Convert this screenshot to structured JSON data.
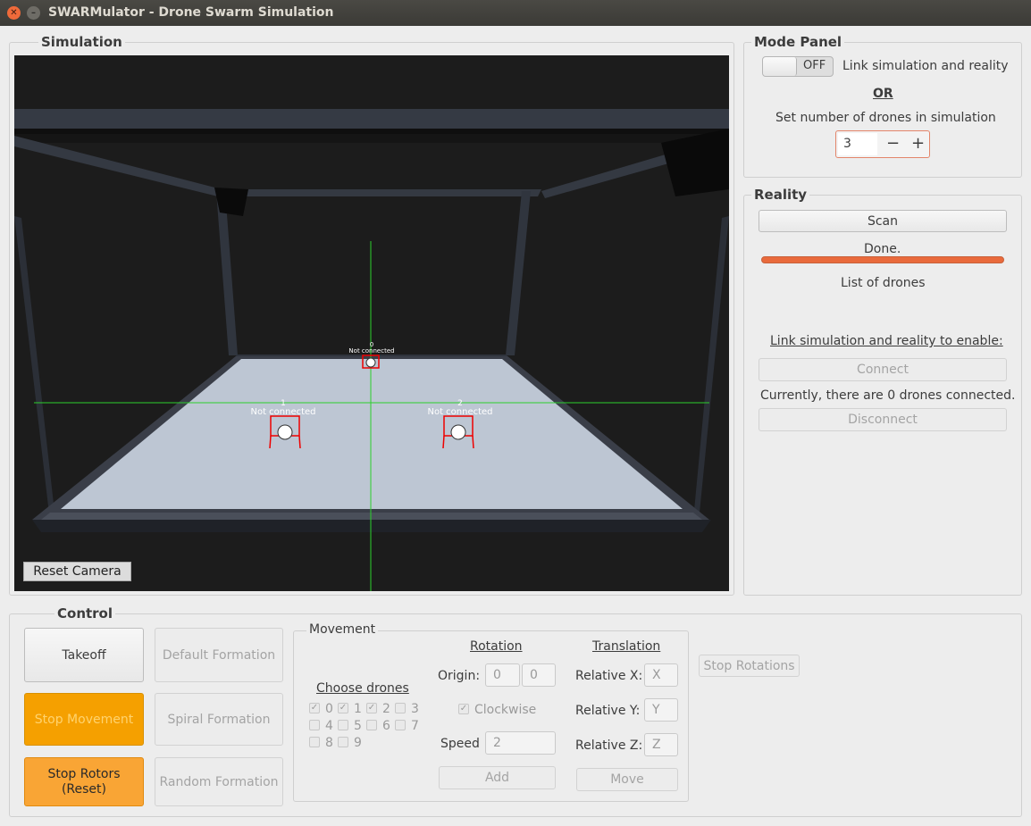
{
  "window": {
    "title": "SWARMulator - Drone Swarm Simulation",
    "close_glyph": "✕",
    "minimize_glyph": "–"
  },
  "simulation": {
    "group_title": "Simulation",
    "reset_camera": "Reset Camera",
    "drones": [
      {
        "id": "0",
        "status": "Not connected"
      },
      {
        "id": "1",
        "status": "Not connected"
      },
      {
        "id": "2",
        "status": "Not connected"
      }
    ]
  },
  "mode_panel": {
    "group_title": "Mode Panel",
    "toggle_state": "OFF",
    "link_label": "Link simulation and reality",
    "or_label": "OR",
    "set_number_label": "Set number of drones in simulation",
    "drone_count": "3",
    "minus": "−",
    "plus": "+"
  },
  "reality": {
    "group_title": "Reality",
    "scan_button": "Scan",
    "status": "Done.",
    "progress": 1.0,
    "list_label": "List of drones",
    "link_hint": "Link simulation and reality to enable:",
    "connect_button": "Connect",
    "connected_info": "Currently, there are 0 drones connected.",
    "disconnect_button": "Disconnect"
  },
  "control": {
    "group_title": "Control",
    "takeoff": "Takeoff",
    "stop_movement": "Stop Movement",
    "stop_rotors": "Stop Rotors\n(Reset)",
    "default_formation": "Default Formation",
    "spiral_formation": "Spiral Formation",
    "random_formation": "Random Formation",
    "stop_rotations": "Stop Rotations"
  },
  "movement": {
    "group_title": "Movement",
    "choose_drones": "Choose drones",
    "checkboxes": [
      {
        "label": "0",
        "checked": true
      },
      {
        "label": "1",
        "checked": true
      },
      {
        "label": "2",
        "checked": true
      },
      {
        "label": "3",
        "checked": false
      },
      {
        "label": "4",
        "checked": false
      },
      {
        "label": "5",
        "checked": false
      },
      {
        "label": "6",
        "checked": false
      },
      {
        "label": "7",
        "checked": false
      },
      {
        "label": "8",
        "checked": false
      },
      {
        "label": "9",
        "checked": false
      }
    ],
    "rotation": {
      "title": "Rotation",
      "origin_label": "Origin:",
      "origin_x": "0",
      "origin_y": "0",
      "clockwise_label": "Clockwise",
      "clockwise_checked": true,
      "speed_label": "Speed",
      "speed_value": "2",
      "add_button": "Add"
    },
    "translation": {
      "title": "Translation",
      "rel_x_label": "Relative X:",
      "rel_x_placeholder": "X",
      "rel_y_label": "Relative Y:",
      "rel_y_placeholder": "Y",
      "rel_z_label": "Relative Z:",
      "rel_z_placeholder": "Z",
      "move_button": "Move"
    }
  }
}
